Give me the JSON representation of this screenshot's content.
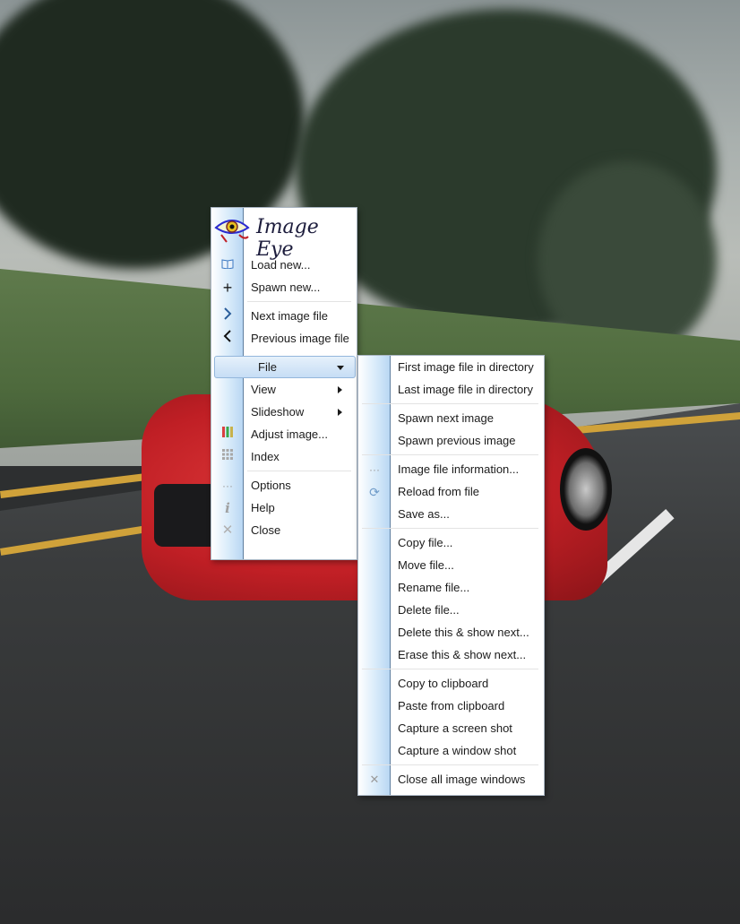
{
  "app": {
    "title": "Image Eye",
    "colors": {
      "menu_border": "#a9b5c2",
      "gutter": "#b9d7f3",
      "highlight": "#c6ddf5"
    }
  },
  "main_menu": {
    "items": [
      {
        "label": "Load new...",
        "icon": "open-book-icon"
      },
      {
        "label": "Spawn new...",
        "icon": "plus-icon"
      },
      {
        "label": "Next image file",
        "icon": "chevron-right-icon"
      },
      {
        "label": "Previous image file",
        "icon": "chevron-left-icon"
      },
      {
        "label": "File",
        "submenu": true,
        "expanded": true
      },
      {
        "label": "View",
        "submenu": true
      },
      {
        "label": "Slideshow",
        "submenu": true
      },
      {
        "label": "Adjust image...",
        "icon": "color-bars-icon"
      },
      {
        "label": "Index",
        "icon": "grid-icon"
      },
      {
        "label": "Options",
        "icon": "ellipsis-icon"
      },
      {
        "label": "Help",
        "icon": "info-icon"
      },
      {
        "label": "Close",
        "icon": "close-icon"
      }
    ]
  },
  "file_menu": {
    "items": [
      {
        "label": "First image file in directory"
      },
      {
        "label": "Last image file in directory"
      },
      {
        "label": "Spawn next image"
      },
      {
        "label": "Spawn previous image"
      },
      {
        "label": "Image file information...",
        "icon": "ellipsis-icon"
      },
      {
        "label": "Reload from file",
        "icon": "reload-icon"
      },
      {
        "label": "Save as..."
      },
      {
        "label": "Copy file..."
      },
      {
        "label": "Move file..."
      },
      {
        "label": "Rename file..."
      },
      {
        "label": "Delete file..."
      },
      {
        "label": "Delete this & show next..."
      },
      {
        "label": "Erase this & show next..."
      },
      {
        "label": "Copy to clipboard"
      },
      {
        "label": "Paste from clipboard"
      },
      {
        "label": "Capture a screen shot"
      },
      {
        "label": "Capture a window shot"
      },
      {
        "label": "Close all image windows",
        "icon": "close-all-icon"
      }
    ]
  }
}
